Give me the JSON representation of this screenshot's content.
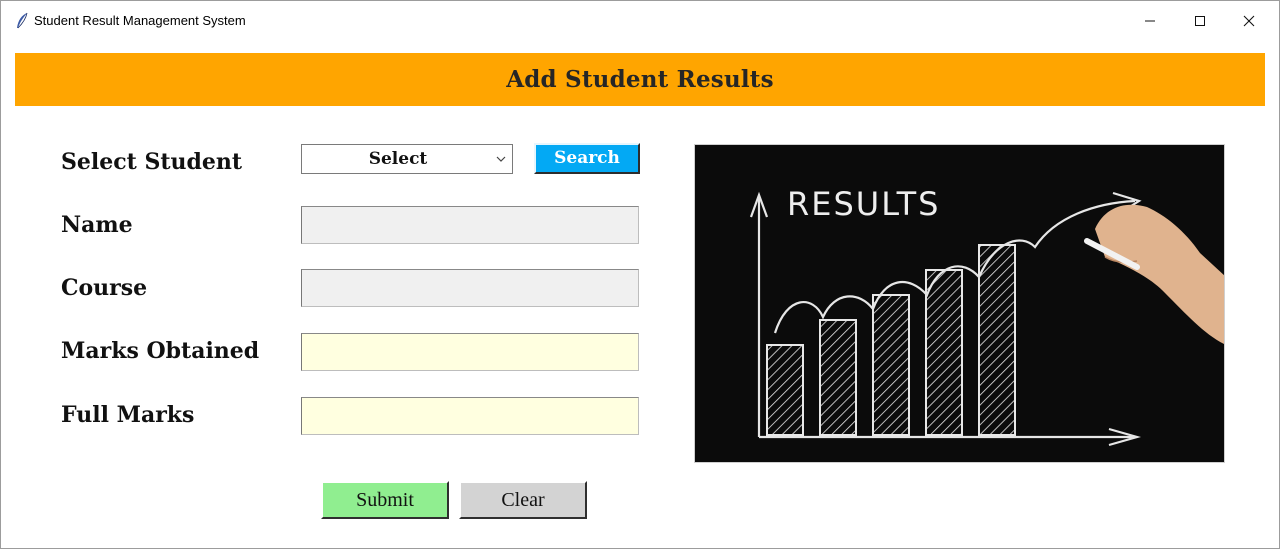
{
  "window": {
    "title": "Student Result Management System",
    "icon": "feather-icon"
  },
  "header": {
    "title": "Add Student Results",
    "bg_color": "#ffa500"
  },
  "form": {
    "select_student_label": "Select Student",
    "select_value": "Select",
    "search_label": "Search",
    "name_label": "Name",
    "name_value": "",
    "course_label": "Course",
    "course_value": "",
    "marks_obtained_label": "Marks Obtained",
    "marks_obtained_value": "",
    "full_marks_label": "Full Marks",
    "full_marks_value": "",
    "submit_label": "Submit",
    "clear_label": "Clear"
  },
  "image": {
    "headline": "RESULTS",
    "bars_relative_heights": [
      0.36,
      0.46,
      0.56,
      0.66,
      0.76
    ]
  },
  "colors": {
    "search": "#03a9f4",
    "submit": "#90ee90",
    "clear": "#d3d3d3",
    "readonly_field": "#f0f0f0",
    "editable_field": "#ffffe0"
  }
}
